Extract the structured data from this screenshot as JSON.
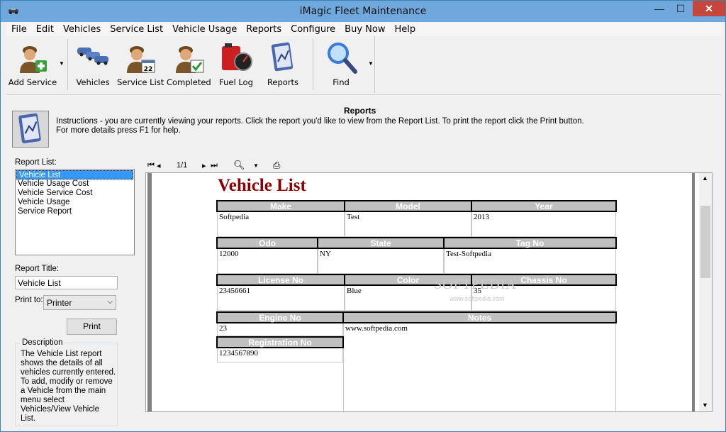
{
  "window": {
    "title": "iMagic Fleet Maintenance",
    "minimize": "—",
    "maximize": "☐",
    "close": "✕"
  },
  "menu": [
    "File",
    "Edit",
    "Vehicles",
    "Service List",
    "Vehicle Usage",
    "Reports",
    "Configure",
    "Buy Now",
    "Help"
  ],
  "toolbar": {
    "add_service": "Add Service",
    "vehicles": "Vehicles",
    "service_list": "Service List",
    "completed": "Completed",
    "fuel_log": "Fuel Log",
    "reports": "Reports",
    "find": "Find",
    "calendar_day": "22"
  },
  "header": {
    "title": "Reports",
    "instructions": "Instructions - you are currently viewing your reports. Click the report you'd like to view from the Report List. To print the report click the Print button. For more details press F1 for help."
  },
  "left": {
    "report_list_label": "Report List:",
    "reports": [
      "Vehicle List",
      "Vehicle Usage Cost",
      "Vehicle Service Cost",
      "Vehicle Usage",
      "Service Report"
    ],
    "report_title_label": "Report Title:",
    "report_title_value": "Vehicle List",
    "print_to_label": "Print to:",
    "print_to_value": "Printer",
    "print_button": "Print",
    "description_legend": "Description",
    "description": "The Vehicle List report shows the details of all vehicles currently entered. To add, modify or remove a Vehicle from the main menu select Vehicles/View Vehicle List."
  },
  "viewer": {
    "page_indicator": "1/1"
  },
  "report": {
    "title": "Vehicle List",
    "headers": {
      "make": "Make",
      "model": "Model",
      "year": "Year",
      "odo": "Odo",
      "state": "State",
      "tag_no": "Tag No",
      "license_no": "License No",
      "color": "Color",
      "chassis_no": "Chassis No",
      "engine_no": "Engine No",
      "notes": "Notes",
      "registration_no": "Registration No"
    },
    "values": {
      "make": "Softpedia",
      "model": "Test",
      "year": "2013",
      "odo": "12000",
      "state": "NY",
      "tag_no": "Test-Softpedia",
      "license_no": "23456661",
      "color": "Blue",
      "chassis_no": "35",
      "engine_no": "23",
      "notes": "www.softpedia.com",
      "registration_no": "1234567890"
    },
    "watermark": "SOFTPEDIA",
    "watermark_sub": "www.softpedia.com"
  }
}
